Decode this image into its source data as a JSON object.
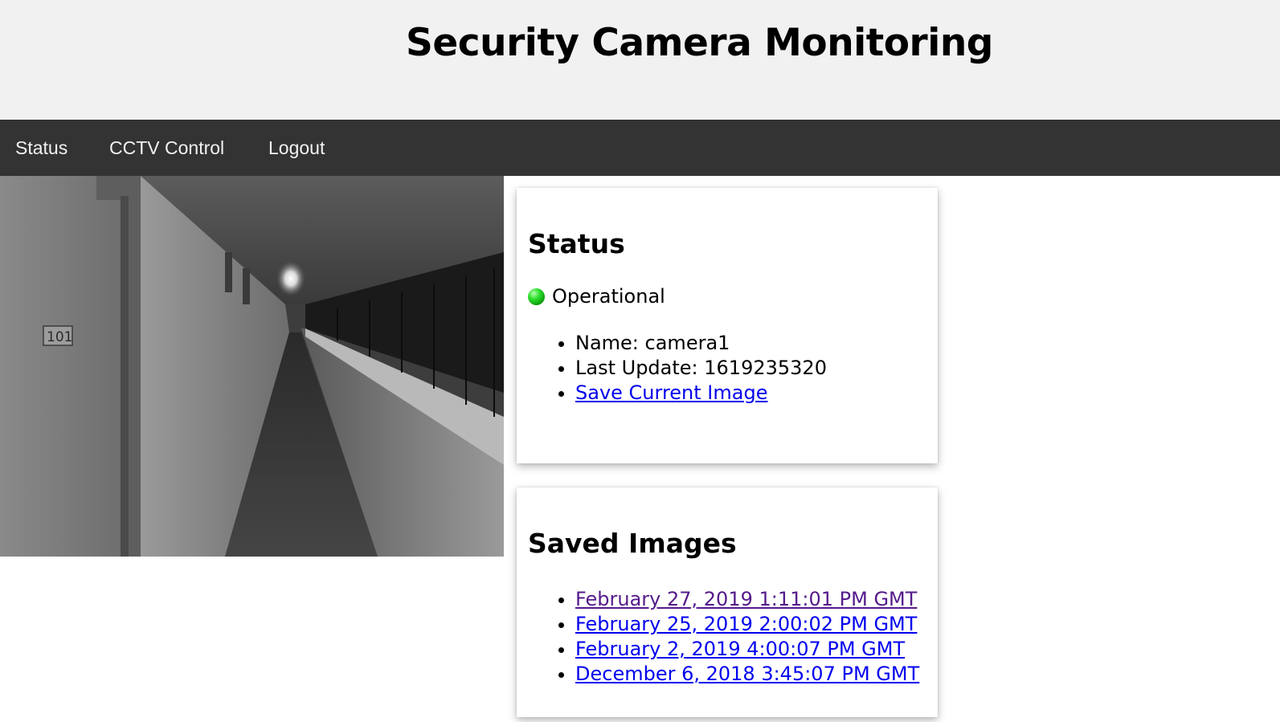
{
  "header": {
    "title": "Security Camera Monitoring"
  },
  "nav": {
    "items": [
      {
        "label": "Status"
      },
      {
        "label": "CCTV Control"
      },
      {
        "label": "Logout"
      }
    ]
  },
  "camera": {
    "door_sign": "101"
  },
  "status_card": {
    "title": "Status",
    "state": "Operational",
    "state_color": "#22c422",
    "name_label": "Name: ",
    "name_value": "camera1",
    "last_update_label": "Last Update: ",
    "last_update_value": "1619235320",
    "save_link": "Save Current Image"
  },
  "saved_card": {
    "title": "Saved Images",
    "images": [
      "February 27, 2019 1:11:01 PM GMT",
      "February 25, 2019 2:00:02 PM GMT",
      "February 2, 2019 4:00:07 PM GMT",
      "December 6, 2018 3:45:07 PM GMT"
    ]
  },
  "colors": {
    "header_bg": "#f1f1f1",
    "nav_bg": "#333333",
    "nav_text": "#f2f2f2",
    "link": "#0000ee",
    "visited_link": "#551a8b"
  }
}
